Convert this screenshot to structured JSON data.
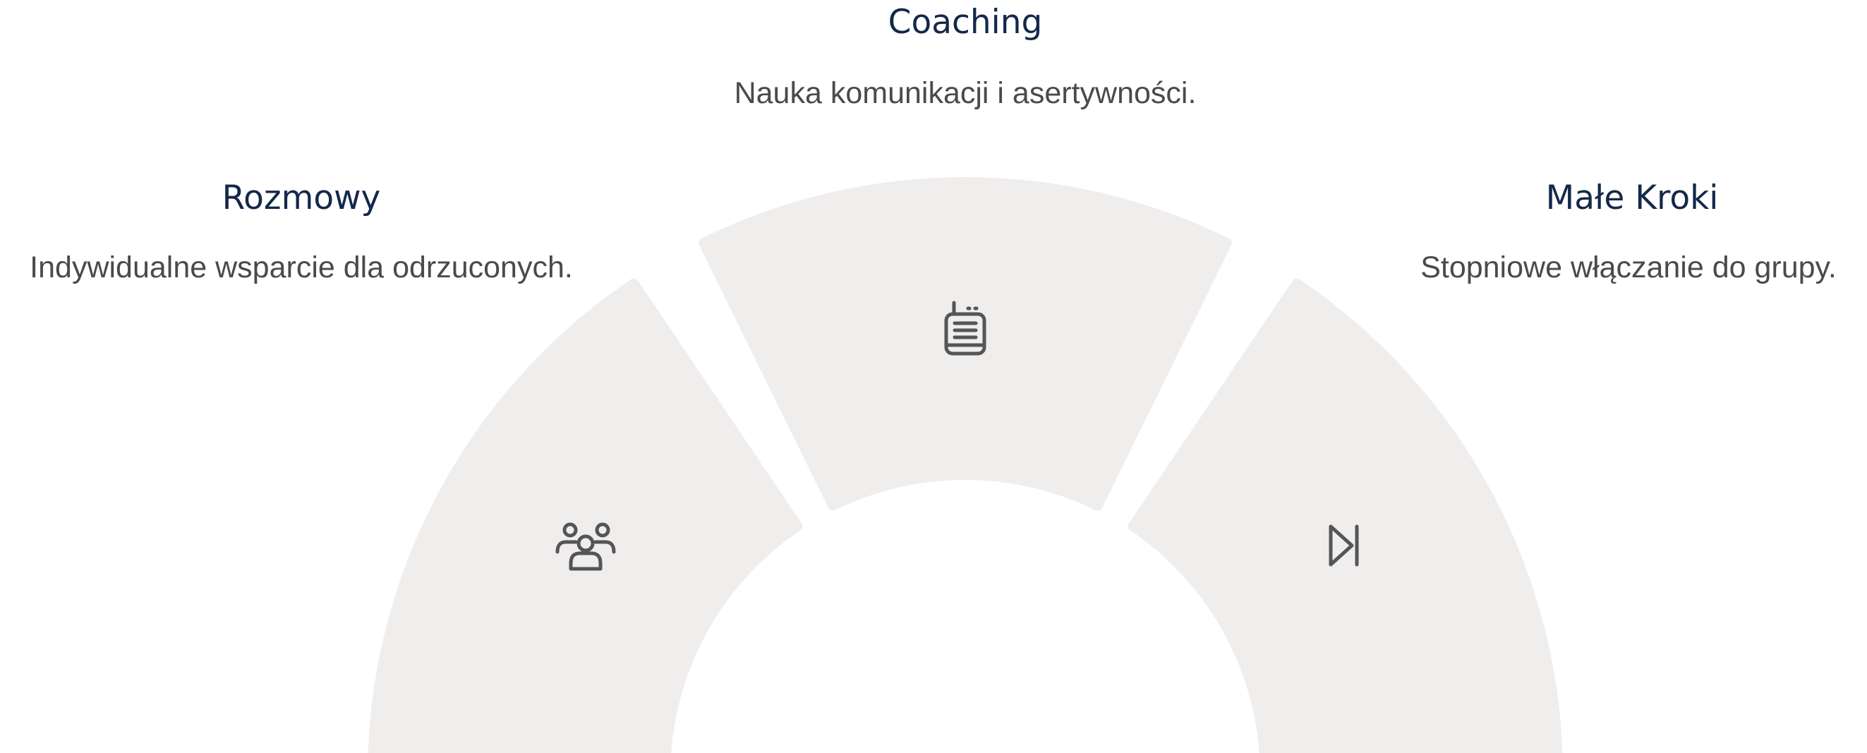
{
  "segments": [
    {
      "id": "top",
      "title": "Coaching",
      "description": "Nauka komunikacji i asertywności.",
      "icon": "walkie-talkie-icon"
    },
    {
      "id": "left",
      "title": "Rozmowy",
      "description": "Indywidualne wsparcie dla odrzuconych.",
      "icon": "group-users-icon"
    },
    {
      "id": "right",
      "title": "Małe Kroki",
      "description": "Stopniowe włączanie do grupy.",
      "icon": "skip-forward-icon"
    }
  ],
  "colors": {
    "segment_fill": "#f0eded",
    "icon_stroke": "#555555",
    "title": "#14284a",
    "description": "#4a4a4a"
  }
}
